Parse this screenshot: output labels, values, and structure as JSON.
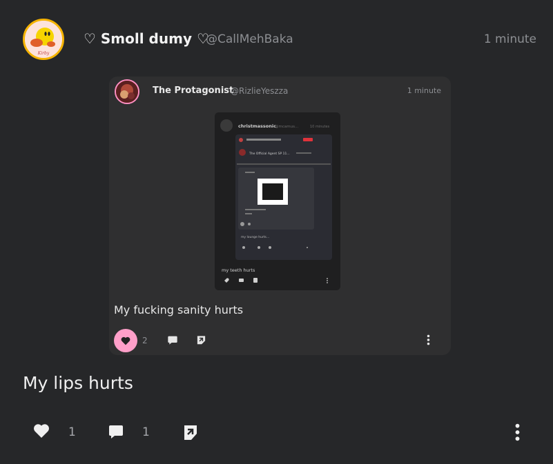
{
  "post": {
    "author": {
      "display_name": "♡ Smoll dumy ♡",
      "handle": "@CallMehBaka",
      "avatar_caption": "Kirby"
    },
    "time": "1 minute",
    "text": "My lips hurts",
    "actions": {
      "like_count": "1",
      "comment_count": "1",
      "like_icon": "heart-icon",
      "comment_icon": "speech-bubble-icon",
      "share_icon": "share-icon",
      "more_icon": "vertical-dots-icon"
    }
  },
  "quoted_post": {
    "author": {
      "display_name": "The Protagonist",
      "handle": "@RizlieYeszza"
    },
    "time": "1 minute",
    "text": "My fucking sanity hurts",
    "actions": {
      "like_count": "2",
      "like_active": true,
      "like_active_color": "#ff9fc9"
    },
    "embedded_screenshot": {
      "author": "christmassonic",
      "handle": "@mcamus...",
      "time": "10 minutes",
      "inner_author": "The Official Agent SP 11...",
      "inner_reply": "my lounge hurts...",
      "text": "my teeth hurts"
    }
  },
  "colors": {
    "background": "#262729",
    "card": "#2f2f30",
    "accent_pink": "#ff9fc9",
    "avatar_ring": "#f5b301"
  }
}
